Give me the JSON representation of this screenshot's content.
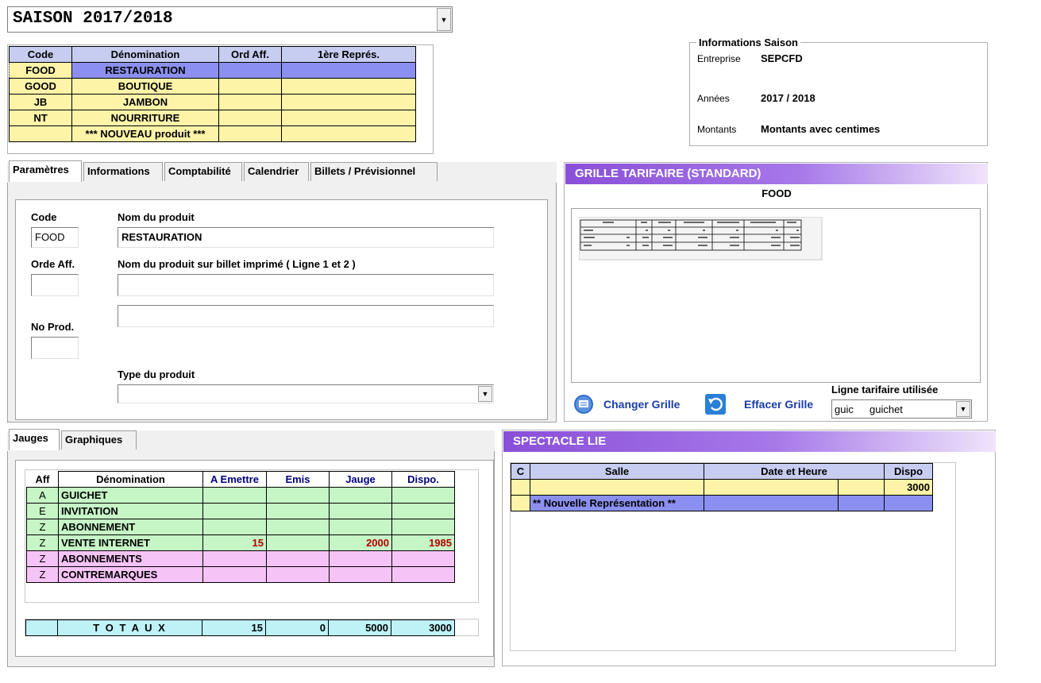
{
  "season": {
    "selected": "SAISON 2017/2018"
  },
  "products": {
    "headers": [
      "Code",
      "Dénomination",
      "Ord Aff.",
      "1ère Représ."
    ],
    "rows": [
      {
        "code": "FOOD",
        "name": "RESTAURATION"
      },
      {
        "code": "GOOD",
        "name": "BOUTIQUE"
      },
      {
        "code": "JB",
        "name": "JAMBON"
      },
      {
        "code": "NT",
        "name": "NOURRITURE"
      },
      {
        "code": "",
        "name": "*** NOUVEAU produit ***"
      }
    ]
  },
  "info_saison": {
    "title": "Informations Saison",
    "entreprise_label": "Entreprise",
    "entreprise": "SEPCFD",
    "annees_label": "Années",
    "annees": "2017 / 2018",
    "montants_label": "Montants",
    "montants": "Montants avec centimes"
  },
  "tabs": [
    "Paramètres",
    "Informations",
    "Comptabilité",
    "Calendrier",
    "Billets / Prévisionnel"
  ],
  "form": {
    "code_label": "Code",
    "code": "FOOD",
    "nom_label": "Nom du produit",
    "nom": "RESTAURATION",
    "orde_label": "Orde Aff.",
    "billet_label": "Nom du produit sur billet imprimé ( Ligne 1 et 2 )",
    "noprod_label": "No Prod.",
    "type_label": "Type du produit"
  },
  "grille": {
    "title": "GRILLE TARIFAIRE (STANDARD)",
    "product": "FOOD",
    "changer": "Changer Grille",
    "effacer": "Effacer Grille",
    "ligne_label": "Ligne tarifaire utilisée",
    "ligne_code": "guic",
    "ligne_name": "guichet"
  },
  "jauge_tabs": [
    "Jauges",
    "Graphiques"
  ],
  "jauges": {
    "headers": [
      "Aff",
      "Dénomination",
      "A Emettre",
      "Emis",
      "Jauge",
      "Dispo."
    ],
    "rows": [
      {
        "aff": "A",
        "name": "GUICHET",
        "emettre": "",
        "emis": "",
        "jauge": "",
        "dispo": "",
        "color": "grn"
      },
      {
        "aff": "E",
        "name": "INVITATION",
        "emettre": "",
        "emis": "",
        "jauge": "",
        "dispo": "",
        "color": "grn"
      },
      {
        "aff": "Z",
        "name": "ABONNEMENT",
        "emettre": "",
        "emis": "",
        "jauge": "",
        "dispo": "",
        "color": "grn"
      },
      {
        "aff": "Z",
        "name": "VENTE INTERNET",
        "emettre": "15",
        "emis": "",
        "jauge": "2000",
        "dispo": "1985",
        "color": "grn"
      },
      {
        "aff": "Z",
        "name": "ABONNEMENTS",
        "emettre": "",
        "emis": "",
        "jauge": "",
        "dispo": "",
        "color": "pnk"
      },
      {
        "aff": "Z",
        "name": "CONTREMARQUES",
        "emettre": "",
        "emis": "",
        "jauge": "",
        "dispo": "",
        "color": "pnk"
      }
    ],
    "totals_label": "T O T A U X",
    "totals": {
      "emettre": "15",
      "emis": "0",
      "jauge": "5000",
      "dispo": "3000"
    }
  },
  "spectacle": {
    "title": "SPECTACLE LIE",
    "headers": [
      "C",
      "Salle",
      "Date et Heure",
      "Dispo"
    ],
    "rows": [
      {
        "c": "",
        "salle": "",
        "date": "",
        "dispo": "3000"
      },
      {
        "c": "",
        "salle": "** Nouvelle Représentation **",
        "date": "",
        "dispo": ""
      }
    ]
  }
}
